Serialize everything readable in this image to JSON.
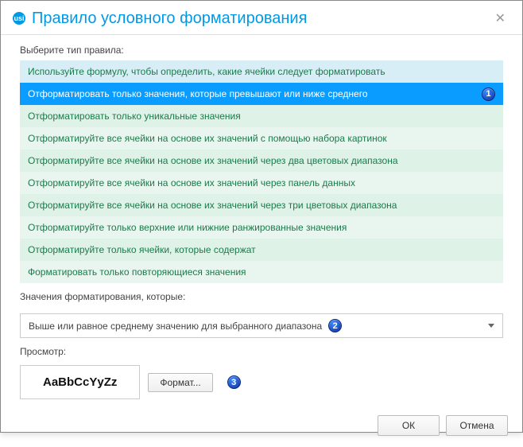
{
  "titlebar": {
    "icon_label": "usi",
    "title": "Правило условного форматирования",
    "close_glyph": "✕"
  },
  "rule_section": {
    "label": "Выберите тип правила:",
    "items": [
      "Используйте формулу, чтобы определить, какие ячейки следует форматировать",
      "Отформатировать только значения, которые превышают или ниже среднего",
      "Отформатировать только уникальные значения",
      "Отформатируйте все ячейки на основе их значений с помощью набора картинок",
      "Отформатируйте все ячейки на основе их значений через два цветовых диапазона",
      "Отформатируйте все ячейки на основе их значений через панель данных",
      "Отформатируйте все ячейки на основе их значений через три цветовых диапазона",
      "Отформатируйте только верхние или нижние ранжированные значения",
      "Отформатируйте только ячейки, которые содержат",
      "Форматировать только повторяющиеся значения"
    ],
    "selected_index": 1
  },
  "format_values_section": {
    "label": "Значения форматирования, которые:",
    "selected": "Выше или равное среднему значению для выбранного диапазона"
  },
  "preview_section": {
    "label": "Просмотр:",
    "sample_text": "AaBbCcYyZz",
    "format_button": "Формат..."
  },
  "footer": {
    "ok": "ОК",
    "cancel": "Отмена"
  },
  "callouts": {
    "one": "1",
    "two": "2",
    "three": "3"
  }
}
